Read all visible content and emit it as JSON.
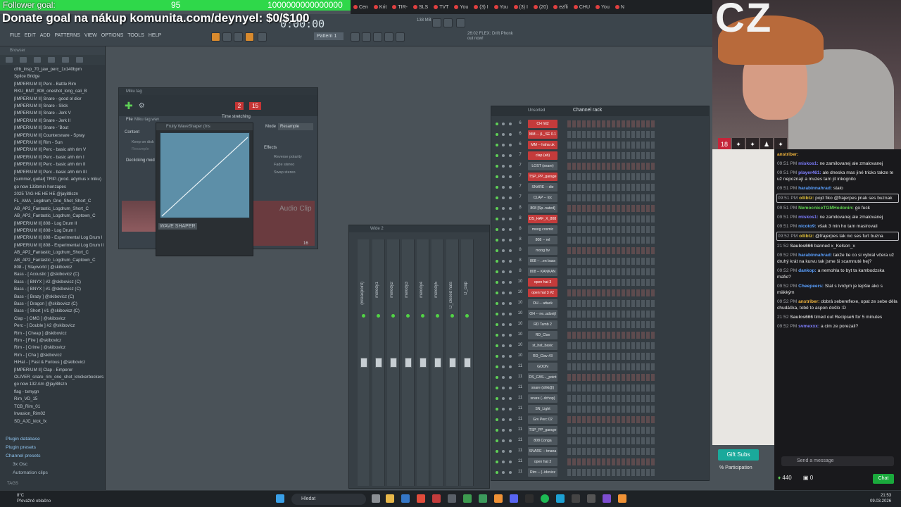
{
  "overlay": {
    "follower_goal_label": "Follower goal:",
    "follower_goal_value": "95",
    "follower_goal_target": "1000000000000000",
    "follower_goal_fraction": 0.0,
    "donate_text": "Donate goal na nákup komunita.com/deynyel: $0/$100"
  },
  "browser_tabs": [
    "Cen",
    "Krit",
    "TIR-",
    "SLS",
    "TVT",
    "You",
    "(3) I",
    "You",
    "(3) I",
    "(20)",
    "ezfli",
    "CHU",
    "You",
    "N"
  ],
  "fl": {
    "menu": [
      "FILE",
      "EDIT",
      "ADD",
      "PATTERNS",
      "VIEW",
      "OPTIONS",
      "TOOLS",
      "HELP"
    ],
    "time": "0:00:00",
    "pattern": "Pattern 1",
    "hint_line1": "26:02  FLEX: Drift Phonk",
    "hint_line2": "out now!",
    "bpm": "138 MB"
  },
  "browser": {
    "header": "Browser",
    "items": [
      "cfrb_insp_70_jaw_perc_1x140bpm",
      "Splice Bridge",
      "[IMPERIUM II] Perc - Battle Rim",
      "RKU_BNT_808_oneshot_long_cali_B",
      "[IMPERIUM II] Snare - good ol dior",
      "[IMPERIUM II] Snare - Slick",
      "[IMPERIUM II] Snare - Jerk V",
      "[IMPERIUM II] Snare - Jerk II",
      "[IMPERIUM II] Snare - 'Bout",
      "[IMPERIUM II] Countersnare - Spray",
      "[IMPERIUM II] Rim - Sun",
      "[IMPERIUM II] Perc - basic ahh rim V",
      "[IMPERIUM II] Perc - basic ahh rim I",
      "[IMPERIUM II] Perc - basic ahh rim II",
      "[IMPERIUM II] Perc - basic ahh rim III",
      "[summer, guitar] TRIP..(prod. adymus x miku)",
      "go now 133bmin honzapes",
      "2025 TAG HE HE HE @jay88szn",
      "FL_AMA_Logdrum_One_Shot_Short_C",
      "AB_AP2_Fantastic_Logdrum_Short_C",
      "AB_AP2_Fantastic_Logdrum_Captown_C",
      "[IMPERIUM II] 808 - Log Drum II",
      "[IMPERIUM II] 808 - Log Drum I",
      "[IMPERIUM II] 808 - Experimental Log Drum I",
      "[IMPERIUM II] 808 - Experimental Log Drum II",
      "AB_AP2_Fantastic_Logdrum_Short_C",
      "AB_AP2_Fantastic_Logdrum_Captown_C",
      "808 - [ Slayworld ] @skibovicz",
      "Bass - [ Acoustic ] @skibovicz (C)",
      "Bass - [ BNYX ] #2 @skibovicz (C)",
      "Bass - [ BNYX ] #1 @skibovicz (C)",
      "Bass - [ Brazy ] @skibovicz (C)",
      "Bass - [ Dragon ] @skibovicz (C)",
      "Bass - [ Short ] #1 @skibovicz (C)",
      "Clap - [ OMG ] @skibovicz",
      "Perc - [ Double ] #2 @skibovicz",
      "Rim - [ Cheap ] @skibovicz",
      "Rim - [ Fire ] @skibovicz",
      "Rim - [ Crime ] @skibovicz",
      "Rim - [ Cha ] @skibovicz",
      "HiHat - [ Fast & Furious ] @skibovicz",
      "[IMPERIUM II] Clap - Emperor",
      "OLIVER_snare_rim_one_shot_knickerbockers",
      "go now 132 Am @jay88szn",
      "flag - txmygn",
      "Rim_VD_15",
      "TCB_Rim_01",
      "Invasion_Rim02",
      "SD_AJC_kick_fx"
    ],
    "folders": [
      "Plugin database",
      "Plugin presets",
      "Channel presets",
      "3x Osc",
      "Automation clips"
    ],
    "tags_label": "TAGS"
  },
  "plugin": {
    "title": "Miku tag",
    "file_label": "File",
    "file_name": "Miku tag.wav",
    "time_stretching": "Time stretching",
    "mode_label": "Mode",
    "mode_value": "Resample",
    "content_label": "Content",
    "keep_on_disk": "Keep on disk",
    "resample": "Resample",
    "declicking": "Declicking mod",
    "effects_label": "Effects",
    "reverse_polarity": "Reverse polarity",
    "fade_stereo": "Fade stereo",
    "swap_stereo": "Swap stereo",
    "audio_clip": "Audio Clip",
    "num_a": "2",
    "num_b": "15",
    "footer_num": "16"
  },
  "waveshaper": {
    "title": "Fruity WaveShaper (Ins",
    "label": "WAVE SHAPER"
  },
  "mixer": {
    "title": "Wide 2",
    "strips": [
      "(Breakpoint)",
      "melody1",
      "melody2",
      "melody3",
      "melody4",
      "melody5",
      "D_closed hats",
      "D_clap"
    ]
  },
  "rack": {
    "filter": "Unsorted",
    "title": "Channel rack",
    "channels": [
      {
        "num": "6",
        "name": "CH hit2",
        "red": true
      },
      {
        "num": "6",
        "name": "MM -- (L_SE 0.1",
        "red": true
      },
      {
        "num": "6",
        "name": "MM -- haha uk",
        "red": true
      },
      {
        "num": "7",
        "name": "clap (ab)",
        "red": true
      },
      {
        "num": "7",
        "name": "LOST (snare)",
        "red": false
      },
      {
        "num": "7",
        "name": "TSP_PP_garage",
        "red": true
      },
      {
        "num": "7",
        "name": "SNARE -- die",
        "red": false
      },
      {
        "num": "7",
        "name": "CLAP -- loc",
        "red": false
      },
      {
        "num": "8",
        "name": "808 [Sp..nated]",
        "red": false
      },
      {
        "num": "8",
        "name": "DS_HAF_X_808",
        "red": true
      },
      {
        "num": "8",
        "name": "moog cosmic",
        "red": false
      },
      {
        "num": "8",
        "name": "808 -- rel",
        "red": false
      },
      {
        "num": "8",
        "name": "moog bv",
        "red": false
      },
      {
        "num": "8",
        "name": "808 -- ..en bass",
        "red": false
      },
      {
        "num": "8",
        "name": "808 -- KANKAN",
        "red": false
      },
      {
        "num": "10",
        "name": "open hat 3",
        "red": true
      },
      {
        "num": "10",
        "name": "open hat 3 #2",
        "red": true
      },
      {
        "num": "10",
        "name": "OH -- attack",
        "red": false
      },
      {
        "num": "10",
        "name": "OH -- ne..adzeijl",
        "red": false
      },
      {
        "num": "10",
        "name": "RD Tamb 2",
        "red": false
      },
      {
        "num": "10",
        "name": "RD_Clav",
        "red": false
      },
      {
        "num": "10",
        "name": "st_hat_basic",
        "red": false
      },
      {
        "num": "10",
        "name": "RD_Clav #3",
        "red": false
      },
      {
        "num": "11",
        "name": "GOON",
        "red": false
      },
      {
        "num": "11",
        "name": "DS_CAS..._point",
        "red": false
      },
      {
        "num": "11",
        "name": "snare (shki@)",
        "red": false
      },
      {
        "num": "11",
        "name": "snare (..dchop)",
        "red": false
      },
      {
        "num": "11",
        "name": "SN_Light",
        "red": false
      },
      {
        "num": "11",
        "name": "Grv Perc 02",
        "red": false
      },
      {
        "num": "11",
        "name": "TSP_PP_garage",
        "red": false
      },
      {
        "num": "11",
        "name": "808 Conga",
        "red": false
      },
      {
        "num": "11",
        "name": "SNARE -- tmana",
        "red": false
      },
      {
        "num": "11",
        "name": "open hat 2",
        "red": false
      },
      {
        "num": "11",
        "name": "Rim -- (..idovicz",
        "red": false
      }
    ]
  },
  "stream": {
    "logo": "CZ",
    "gift_subs": "Gift Subs",
    "participation": "% Participation",
    "chat_placeholder": "Send a message",
    "points": "440",
    "counter": "0",
    "chat_button": "Chat",
    "messages": [
      {
        "time": "",
        "user": "anstriber:",
        "text": "",
        "color": "#f0b43c",
        "hl": false
      },
      {
        "time": "09:51 PM",
        "user": "miskos1:",
        "text": "ne zamilovanej ale zmalovanej",
        "color": "#7d7dff",
        "hl": false
      },
      {
        "time": "09:51 PM",
        "user": "player461:",
        "text": "ale dneska mas jiné tricko takze te už nepoznají a muzes tam jit inkognito",
        "color": "#8080ff",
        "hl": false
      },
      {
        "time": "09:51 PM",
        "user": "harabinnahrad:",
        "text": "stalo",
        "color": "#5aa0ff",
        "hl": false
      },
      {
        "time": "09:51 PM",
        "user": "ollibtz:",
        "text": "pojd fiko @frajerpes jinak ses buznak",
        "color": "#e2c23b",
        "hl": true
      },
      {
        "time": "09:51 PM",
        "user": "NemocniceTGMHodonin:",
        "text": "go fuck",
        "color": "#5fd14f",
        "hl": false
      },
      {
        "time": "09:51 PM",
        "user": "miskos1:",
        "text": "ne zamilovanej ale zmalovanej",
        "color": "#7d7dff",
        "hl": false
      },
      {
        "time": "09:51 PM",
        "user": "nicoto9:",
        "text": "však 3 min ho tam masirovali",
        "color": "#5aa0ff",
        "hl": false
      },
      {
        "time": "09:52 PM",
        "user": "ollibtz:",
        "text": "@frajerpes tak nic ses furt buzna",
        "color": "#e2c23b",
        "hl": true
      },
      {
        "time": "21:52",
        "user": "Saulos666",
        "text": "banned x_Kelson_x",
        "color": "#c7c7c7",
        "hl": false
      },
      {
        "time": "09:52 PM",
        "user": "harabinnahrad:",
        "text": "takže tie co si vybral včera už druhý krát na kurvu tak jsme ši scamnuté hej?",
        "color": "#5aa0ff",
        "hl": false
      },
      {
        "time": "09:52 PM",
        "user": "dankop:",
        "text": "a nemohla to byt ta kambodzska mafie?",
        "color": "#5aa0ff",
        "hl": false
      },
      {
        "time": "09:52 PM",
        "user": "Cheepeers:",
        "text": "Stat s tvrdym je lepšie ako s mäkkým",
        "color": "#5aa0ff",
        "hl": false
      },
      {
        "time": "09:52 PM",
        "user": "anstriber:",
        "text": "dobrá sebereflexe, opat ze sebe děla chudáčka, tobě to aspon došlo :D",
        "color": "#f0b43c",
        "hl": false
      },
      {
        "time": "21:52",
        "user": "Saulos666",
        "text": "timed out Recipse6 for 5 minutes",
        "color": "#c7c7c7",
        "hl": false
      },
      {
        "time": "09:52 PM",
        "user": "svmexxx:",
        "text": "a cim ze porezali?",
        "color": "#8080ff",
        "hl": false
      }
    ]
  },
  "taskbar": {
    "weather_temp": "8°C",
    "weather_desc": "Převážně oblačno",
    "search": "Hledat",
    "clock_time": "21:53",
    "clock_date": "09.03.2026"
  }
}
